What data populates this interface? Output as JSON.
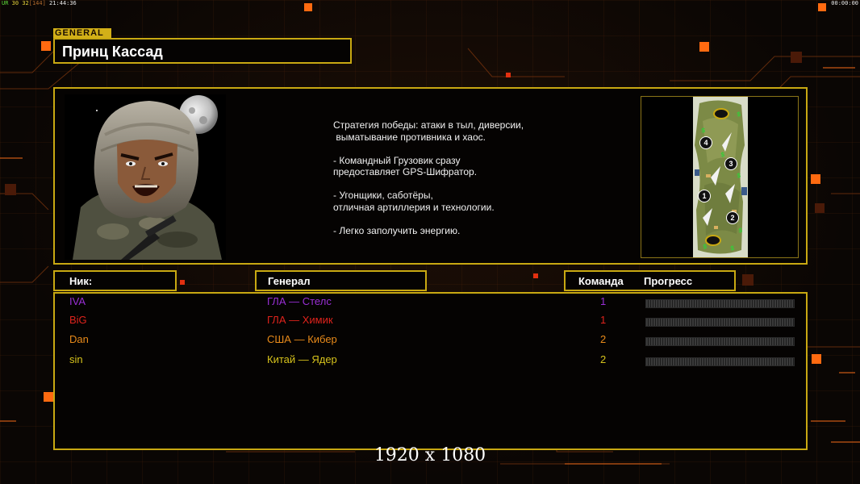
{
  "top_bar": {
    "left_tag": "UR",
    "fps": "30",
    "target_fps": "32",
    "frames": "[144]",
    "time_left": "21:44:36",
    "time_right": "00:00:00"
  },
  "general": {
    "tag": "GENERAL",
    "name": "Принц Кассад",
    "description": "Стратегия победы: атаки в тыл, диверсии,\n выматывание противника и хаос.\n\n- Командный Грузовик сразу\nпредоставляет GPS-Шифратор.\n\n- Угонщики, саботёры,\nотличная артиллерия и технологии.\n\n- Легко заполучить энергию."
  },
  "map": {
    "start_positions": [
      "1",
      "2",
      "3",
      "4"
    ]
  },
  "table": {
    "headers": {
      "nick": "Ник:",
      "general": "Генерал",
      "team": "Команда",
      "progress": "Прогресс"
    },
    "players": [
      {
        "nick": "IVA",
        "general": "ГЛА — Стелс",
        "team": "1",
        "color": "#9a2fd6",
        "progress": 0
      },
      {
        "nick": "BiG",
        "general": "ГЛА — Химик",
        "team": "1",
        "color": "#e0231c",
        "progress": 0
      },
      {
        "nick": "Dan",
        "general": "США — Кибер",
        "team": "2",
        "color": "#e88a1a",
        "progress": 0
      },
      {
        "nick": "sin",
        "general": "Китай — Ядер",
        "team": "2",
        "color": "#d6c21c",
        "progress": 0
      }
    ]
  },
  "resolution_label": "1920 x 1080",
  "colors": {
    "frame": "#c8a812",
    "accent_orange": "#ff6a10"
  }
}
